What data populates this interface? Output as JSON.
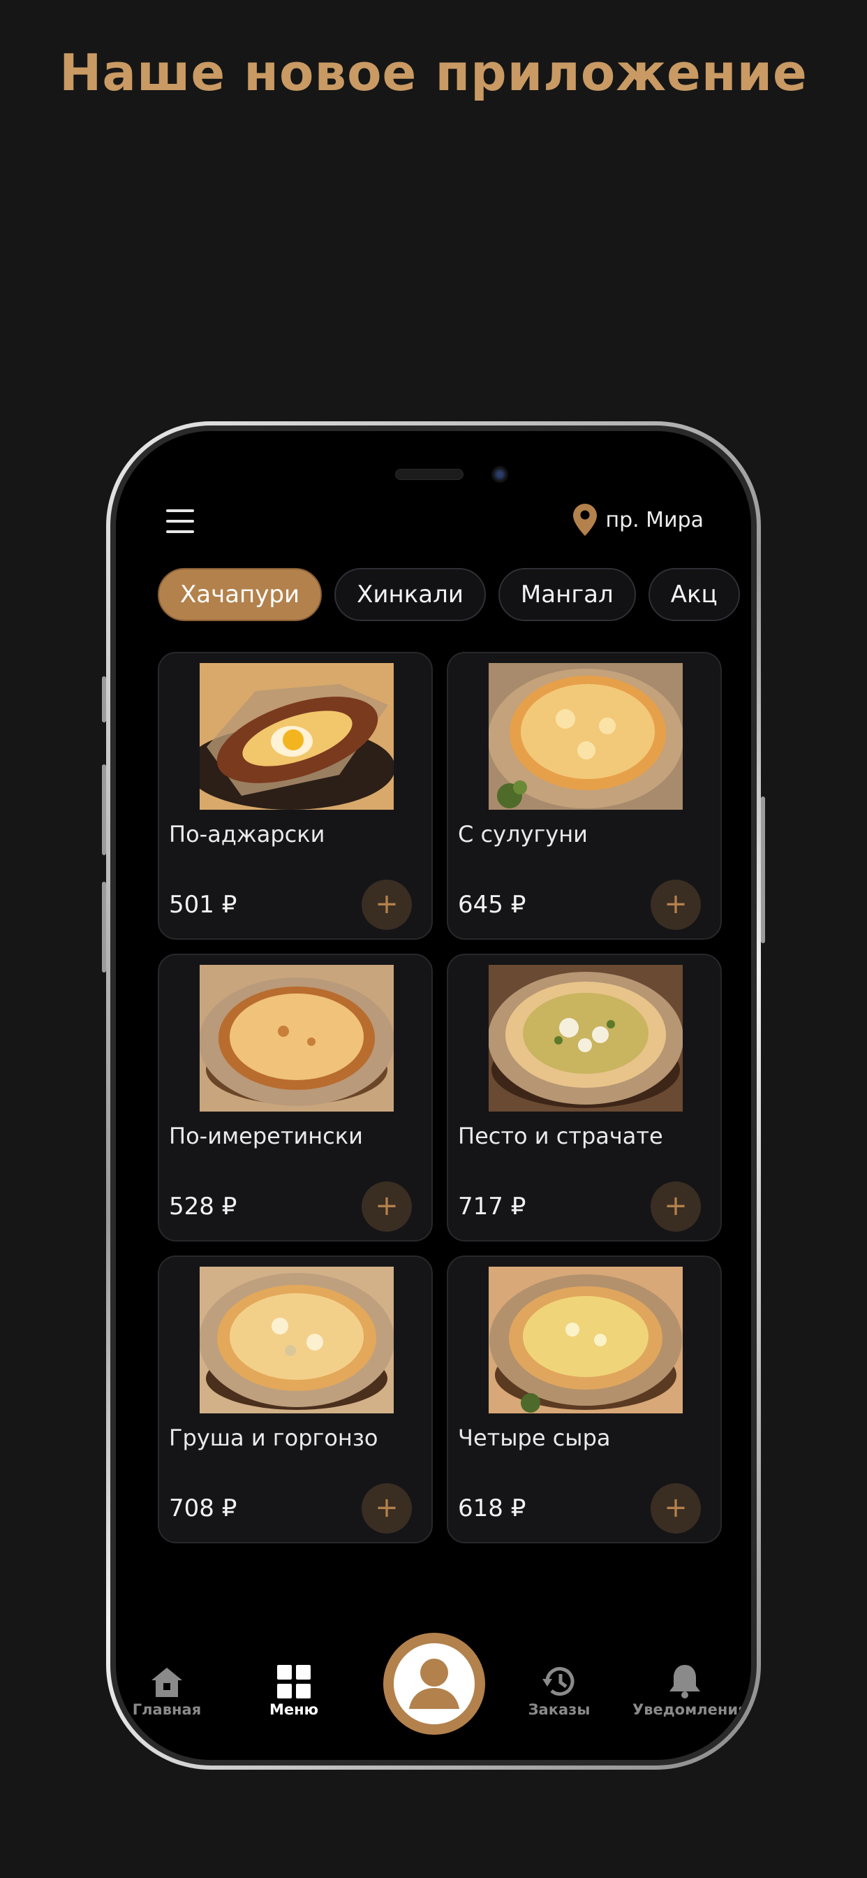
{
  "headline": "Наше новое приложение",
  "header": {
    "location": "пр. Мира"
  },
  "categories": [
    {
      "label": "Хачапури",
      "active": true
    },
    {
      "label": "Хинкали",
      "active": false
    },
    {
      "label": "Мангал",
      "active": false
    },
    {
      "label": "Акц",
      "active": false
    }
  ],
  "products": [
    {
      "name": "По-аджарски",
      "price": "501 ₽"
    },
    {
      "name": "С сулугуни",
      "price": "645 ₽"
    },
    {
      "name": "По-имеретински",
      "price": "528 ₽"
    },
    {
      "name": "Песто и страчате",
      "price": "717 ₽"
    },
    {
      "name": "Груша и горгонзо",
      "price": "708 ₽"
    },
    {
      "name": "Четыре сыра",
      "price": "618 ₽"
    }
  ],
  "add_label": "+",
  "nav": {
    "home": "Главная",
    "menu": "Меню",
    "orders": "Заказы",
    "notifications": "Уведомления"
  },
  "colors": {
    "accent": "#B3814C",
    "headline": "#C99A63",
    "background": "#161616",
    "screen": "#000000"
  },
  "icons": [
    "menu-icon",
    "location-pin-icon",
    "home-icon",
    "grid-icon",
    "profile-icon",
    "history-icon",
    "bell-icon",
    "plus-icon"
  ]
}
